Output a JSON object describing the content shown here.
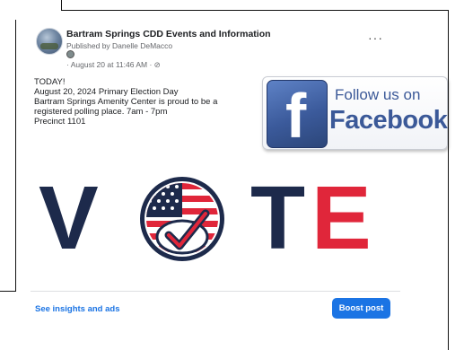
{
  "post": {
    "page_name": "Bartram Springs CDD Events and Information",
    "published_by": "Published by Danelle DeMacco",
    "timestamp": "· August 20 at 11:46 AM · ⊘",
    "more_options": "···",
    "text_lines": [
      "TODAY!",
      "August 20, 2024 Primary Election Day",
      "Bartram Springs Amenity Center is proud to be a",
      "registered polling place. 7am - 7pm",
      "Precinct 1101"
    ]
  },
  "facebook_badge": {
    "icon_letter": "f",
    "follow_text": "Follow us on",
    "brand_text": "Facebook"
  },
  "vote_graphic": {
    "letters": [
      "V",
      "T",
      "E"
    ],
    "colors": {
      "navy": "#1d2a4b",
      "red": "#e0263a"
    }
  },
  "footer": {
    "insights_link": "See insights and ads",
    "boost_button": "Boost post"
  },
  "colors": {
    "accent": "#1b74e4",
    "facebook_blue": "#3b5998"
  }
}
